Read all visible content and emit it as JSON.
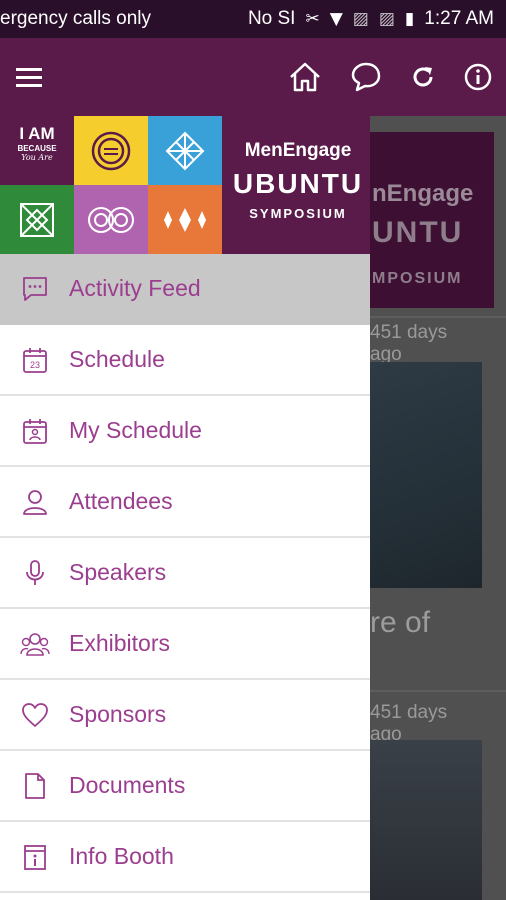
{
  "status_bar": {
    "carrier_text": "ergency calls only",
    "sim_text": "No SI",
    "time": "1:27 AM"
  },
  "brand": {
    "tile_text_line1": "I AM",
    "tile_text_line2": "BECAUSE",
    "tile_text_line3": "You Are",
    "name_line1": "MenEngage",
    "name_line2": "UBUNTU",
    "name_line3": "SYMPOSIUM"
  },
  "menu": {
    "items": [
      {
        "label": "Activity Feed",
        "icon": "chat-icon",
        "active": true
      },
      {
        "label": "Schedule",
        "icon": "calendar-icon",
        "active": false
      },
      {
        "label": "My Schedule",
        "icon": "my-calendar-icon",
        "active": false
      },
      {
        "label": "Attendees",
        "icon": "person-icon",
        "active": false
      },
      {
        "label": "Speakers",
        "icon": "microphone-icon",
        "active": false
      },
      {
        "label": "Exhibitors",
        "icon": "people-icon",
        "active": false
      },
      {
        "label": "Sponsors",
        "icon": "heart-icon",
        "active": false
      },
      {
        "label": "Documents",
        "icon": "document-icon",
        "active": false
      },
      {
        "label": "Info Booth",
        "icon": "info-booth-icon",
        "active": false
      }
    ]
  },
  "background_feed": {
    "card_name_line1": "nEngage",
    "card_name_line2": "UNTU",
    "card_name_line3": "MPOSIUM",
    "post1_time": "451 days ago",
    "post1_text": "re of",
    "post2_time": "451 days ago"
  },
  "colors": {
    "brand_purple": "#5a1a4a",
    "accent": "#9b3e8f",
    "active_bg": "#c7c7c7"
  }
}
